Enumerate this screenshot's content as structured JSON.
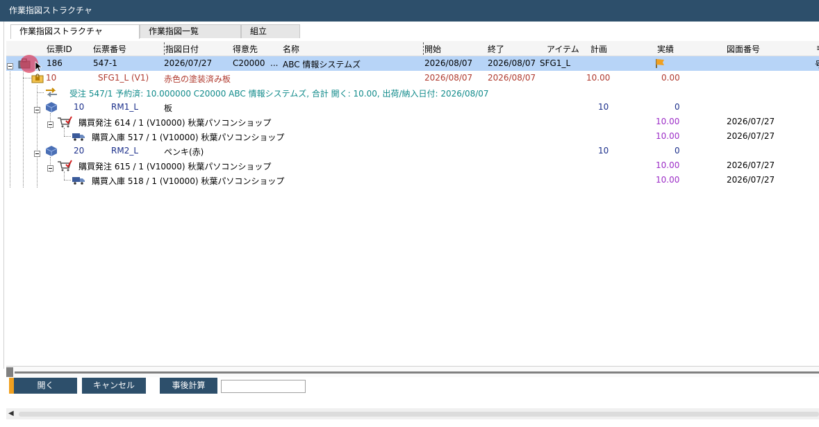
{
  "window": {
    "title": "作業指図ストラクチャ"
  },
  "tabs": [
    {
      "label": "作業指図ストラクチャ"
    },
    {
      "label": "作業指図一覧"
    },
    {
      "label": "組立"
    }
  ],
  "columns": [
    "伝票ID",
    "伝票番号",
    "指図日付",
    "得意先",
    "名称",
    "開始",
    "終了",
    "アイテム",
    "計画",
    "実績",
    "図面番号",
    "≡"
  ],
  "rows": {
    "r1": {
      "doc_id": "186",
      "doc_no": "547-1",
      "date": "2026/07/27",
      "customer": "C20000",
      "ellipsis": "...",
      "name": "ABC 情報システムズ",
      "start": "2026/08/07",
      "end": "2026/08/07",
      "item": "SFG1_L",
      "overflow": "号"
    },
    "r2": {
      "qty": "10",
      "item": "SFG1_L (V1)",
      "desc": "赤色の塗装済み板",
      "start": "2026/08/07",
      "end": "2026/08/07",
      "plan": "10.00",
      "actual": "0.00"
    },
    "r3": {
      "text": "受注 547/1 予約済: 10.000000  C20000 ABC 情報システムズ, 合計 開く: 10.00, 出荷/納入日付: 2026/08/07"
    },
    "r4": {
      "qty": "10",
      "item": "RM1_L",
      "desc": "板",
      "plan": "10",
      "actual": "0"
    },
    "r5": {
      "text": "購買発注 614 / 1 (V10000) 秋葉パソコンショップ",
      "qty": "10.00",
      "date": "2026/07/27"
    },
    "r6": {
      "text": "購買入庫 517 / 1 (V10000) 秋葉パソコンショップ",
      "qty": "10.00",
      "date": "2026/07/27"
    },
    "r7": {
      "qty": "20",
      "item": "RM2_L",
      "desc": "ペンキ(赤)",
      "plan": "10",
      "actual": "0"
    },
    "r8": {
      "text": "購買発注 615 / 1 (V10000) 秋葉パソコンショップ",
      "qty": "10.00",
      "date": "2026/07/27"
    },
    "r9": {
      "text": "購買入庫 518 / 1 (V10000) 秋葉パソコンショップ",
      "qty": "10.00",
      "date": "2026/07/27"
    }
  },
  "buttons": {
    "open": "開く",
    "cancel": "キャンセル",
    "post_calc": "事後計算"
  },
  "colors": {
    "titlebar": "#2d4f6b",
    "selected_row": "#b7d4f7",
    "accent": "#f0a020"
  }
}
